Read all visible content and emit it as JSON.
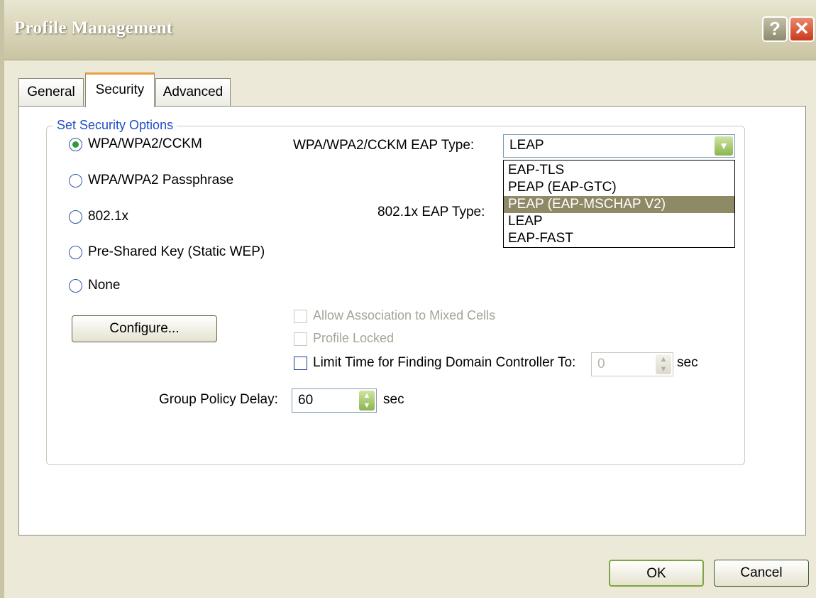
{
  "window": {
    "title": "Profile Management"
  },
  "titlebar": {
    "help_label": "?",
    "close_label": "✕"
  },
  "tabs": [
    {
      "label": "General"
    },
    {
      "label": "Security"
    },
    {
      "label": "Advanced"
    }
  ],
  "security": {
    "group_title": "Set Security Options",
    "options": [
      {
        "label": "WPA/WPA2/CCKM",
        "checked": true
      },
      {
        "label": "WPA/WPA2 Passphrase",
        "checked": false
      },
      {
        "label": "802.1x",
        "checked": false
      },
      {
        "label": "Pre-Shared Key (Static WEP)",
        "checked": false
      },
      {
        "label": "None",
        "checked": false
      }
    ],
    "wpa_eap_label": "WPA/WPA2/CCKM EAP Type:",
    "wpa_eap_value": "LEAP",
    "dot1x_eap_label": "802.1x EAP Type:",
    "eap_options": [
      {
        "label": "EAP-TLS",
        "highlighted": false
      },
      {
        "label": "PEAP (EAP-GTC)",
        "highlighted": false
      },
      {
        "label": "PEAP (EAP-MSCHAP V2)",
        "highlighted": true
      },
      {
        "label": "LEAP",
        "highlighted": false
      },
      {
        "label": "EAP-FAST",
        "highlighted": false
      }
    ],
    "configure_label": "Configure...",
    "allow_mixed_label": "Allow Association to Mixed Cells",
    "profile_locked_label": "Profile Locked",
    "limit_time_label": "Limit Time for Finding Domain Controller To:",
    "limit_time_value": "0",
    "limit_time_unit": "sec",
    "group_policy_label": "Group Policy Delay:",
    "group_policy_value": "60",
    "group_policy_unit": "sec"
  },
  "footer": {
    "ok_label": "OK",
    "cancel_label": "Cancel"
  }
}
